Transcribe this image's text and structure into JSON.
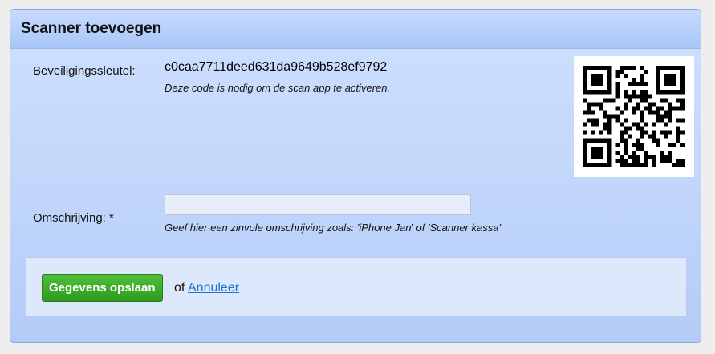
{
  "panel": {
    "title": "Scanner toevoegen"
  },
  "security": {
    "label": "Beveiligingssleutel:",
    "key": "c0caa7711deed631da9649b528ef9792",
    "hint": "Deze code is nodig om de scan app te activeren.",
    "qr_icon": "qr-code"
  },
  "description": {
    "label": "Omschrijving: *",
    "value": "",
    "placeholder": "",
    "hint": "Geef hier een zinvole omschrijving zoals: 'iPhone Jan' of 'Scanner kassa'"
  },
  "actions": {
    "save_label": "Gegevens opslaan",
    "of_text": "of",
    "cancel_label": "Annuleer"
  },
  "colors": {
    "save_button": "#3aa829",
    "link": "#1a73c9",
    "panel_border": "#8aa6d8"
  }
}
